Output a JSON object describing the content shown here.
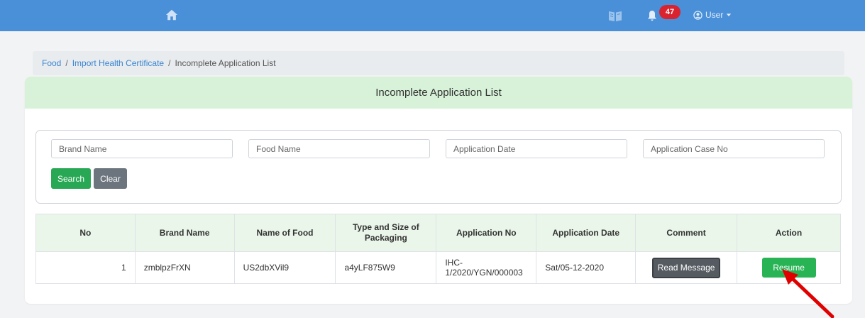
{
  "topbar": {
    "notifications_count": "47",
    "user_label": "User",
    "icons": [
      "home-icon",
      "book-icon",
      "bell-icon",
      "user-circle-icon",
      "caret-down-icon"
    ],
    "color": "#4a90d9"
  },
  "breadcrumb": {
    "items": [
      "Food",
      "Import Health Certificate"
    ],
    "separator": "/",
    "current": "Incomplete Application List"
  },
  "page": {
    "title": "Incomplete Application List"
  },
  "search": {
    "brand_placeholder": "Brand Name",
    "food_placeholder": "Food Name",
    "date_placeholder": "Application Date",
    "case_placeholder": "Application Case No",
    "search_label": "Search",
    "clear_label": "Clear"
  },
  "table": {
    "headers": [
      "No",
      "Brand Name",
      "Name of Food",
      "Type and Size of Packaging",
      "Application No",
      "Application Date",
      "Comment",
      "Action"
    ],
    "rows": [
      {
        "no": "1",
        "brand": "zmblpzFrXN",
        "food": "US2dbXVil9",
        "packaging": "a4yLF875W9",
        "app_no": "IHC-1/2020/YGN/000003",
        "app_date": "Sat/05-12-2020",
        "comment_button": "Read Message",
        "action_button": "Resume"
      }
    ]
  },
  "colors": {
    "header_green": "#d7f2d8",
    "search_button": "#28a855",
    "clear_button": "#6c757d",
    "badge": "#d9232f",
    "arrow": "#e00000"
  }
}
